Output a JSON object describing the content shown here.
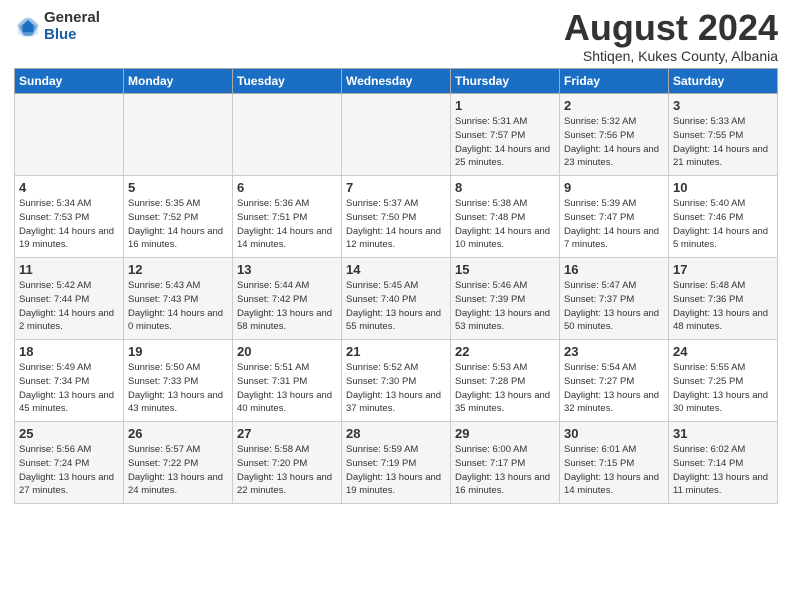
{
  "header": {
    "logo_general": "General",
    "logo_blue": "Blue",
    "month": "August 2024",
    "location": "Shtiqen, Kukes County, Albania"
  },
  "columns": [
    "Sunday",
    "Monday",
    "Tuesday",
    "Wednesday",
    "Thursday",
    "Friday",
    "Saturday"
  ],
  "weeks": [
    [
      {
        "day": "",
        "text": ""
      },
      {
        "day": "",
        "text": ""
      },
      {
        "day": "",
        "text": ""
      },
      {
        "day": "",
        "text": ""
      },
      {
        "day": "1",
        "text": "Sunrise: 5:31 AM\nSunset: 7:57 PM\nDaylight: 14 hours and 25 minutes."
      },
      {
        "day": "2",
        "text": "Sunrise: 5:32 AM\nSunset: 7:56 PM\nDaylight: 14 hours and 23 minutes."
      },
      {
        "day": "3",
        "text": "Sunrise: 5:33 AM\nSunset: 7:55 PM\nDaylight: 14 hours and 21 minutes."
      }
    ],
    [
      {
        "day": "4",
        "text": "Sunrise: 5:34 AM\nSunset: 7:53 PM\nDaylight: 14 hours and 19 minutes."
      },
      {
        "day": "5",
        "text": "Sunrise: 5:35 AM\nSunset: 7:52 PM\nDaylight: 14 hours and 16 minutes."
      },
      {
        "day": "6",
        "text": "Sunrise: 5:36 AM\nSunset: 7:51 PM\nDaylight: 14 hours and 14 minutes."
      },
      {
        "day": "7",
        "text": "Sunrise: 5:37 AM\nSunset: 7:50 PM\nDaylight: 14 hours and 12 minutes."
      },
      {
        "day": "8",
        "text": "Sunrise: 5:38 AM\nSunset: 7:48 PM\nDaylight: 14 hours and 10 minutes."
      },
      {
        "day": "9",
        "text": "Sunrise: 5:39 AM\nSunset: 7:47 PM\nDaylight: 14 hours and 7 minutes."
      },
      {
        "day": "10",
        "text": "Sunrise: 5:40 AM\nSunset: 7:46 PM\nDaylight: 14 hours and 5 minutes."
      }
    ],
    [
      {
        "day": "11",
        "text": "Sunrise: 5:42 AM\nSunset: 7:44 PM\nDaylight: 14 hours and 2 minutes."
      },
      {
        "day": "12",
        "text": "Sunrise: 5:43 AM\nSunset: 7:43 PM\nDaylight: 14 hours and 0 minutes."
      },
      {
        "day": "13",
        "text": "Sunrise: 5:44 AM\nSunset: 7:42 PM\nDaylight: 13 hours and 58 minutes."
      },
      {
        "day": "14",
        "text": "Sunrise: 5:45 AM\nSunset: 7:40 PM\nDaylight: 13 hours and 55 minutes."
      },
      {
        "day": "15",
        "text": "Sunrise: 5:46 AM\nSunset: 7:39 PM\nDaylight: 13 hours and 53 minutes."
      },
      {
        "day": "16",
        "text": "Sunrise: 5:47 AM\nSunset: 7:37 PM\nDaylight: 13 hours and 50 minutes."
      },
      {
        "day": "17",
        "text": "Sunrise: 5:48 AM\nSunset: 7:36 PM\nDaylight: 13 hours and 48 minutes."
      }
    ],
    [
      {
        "day": "18",
        "text": "Sunrise: 5:49 AM\nSunset: 7:34 PM\nDaylight: 13 hours and 45 minutes."
      },
      {
        "day": "19",
        "text": "Sunrise: 5:50 AM\nSunset: 7:33 PM\nDaylight: 13 hours and 43 minutes."
      },
      {
        "day": "20",
        "text": "Sunrise: 5:51 AM\nSunset: 7:31 PM\nDaylight: 13 hours and 40 minutes."
      },
      {
        "day": "21",
        "text": "Sunrise: 5:52 AM\nSunset: 7:30 PM\nDaylight: 13 hours and 37 minutes."
      },
      {
        "day": "22",
        "text": "Sunrise: 5:53 AM\nSunset: 7:28 PM\nDaylight: 13 hours and 35 minutes."
      },
      {
        "day": "23",
        "text": "Sunrise: 5:54 AM\nSunset: 7:27 PM\nDaylight: 13 hours and 32 minutes."
      },
      {
        "day": "24",
        "text": "Sunrise: 5:55 AM\nSunset: 7:25 PM\nDaylight: 13 hours and 30 minutes."
      }
    ],
    [
      {
        "day": "25",
        "text": "Sunrise: 5:56 AM\nSunset: 7:24 PM\nDaylight: 13 hours and 27 minutes."
      },
      {
        "day": "26",
        "text": "Sunrise: 5:57 AM\nSunset: 7:22 PM\nDaylight: 13 hours and 24 minutes."
      },
      {
        "day": "27",
        "text": "Sunrise: 5:58 AM\nSunset: 7:20 PM\nDaylight: 13 hours and 22 minutes."
      },
      {
        "day": "28",
        "text": "Sunrise: 5:59 AM\nSunset: 7:19 PM\nDaylight: 13 hours and 19 minutes."
      },
      {
        "day": "29",
        "text": "Sunrise: 6:00 AM\nSunset: 7:17 PM\nDaylight: 13 hours and 16 minutes."
      },
      {
        "day": "30",
        "text": "Sunrise: 6:01 AM\nSunset: 7:15 PM\nDaylight: 13 hours and 14 minutes."
      },
      {
        "day": "31",
        "text": "Sunrise: 6:02 AM\nSunset: 7:14 PM\nDaylight: 13 hours and 11 minutes."
      }
    ]
  ]
}
